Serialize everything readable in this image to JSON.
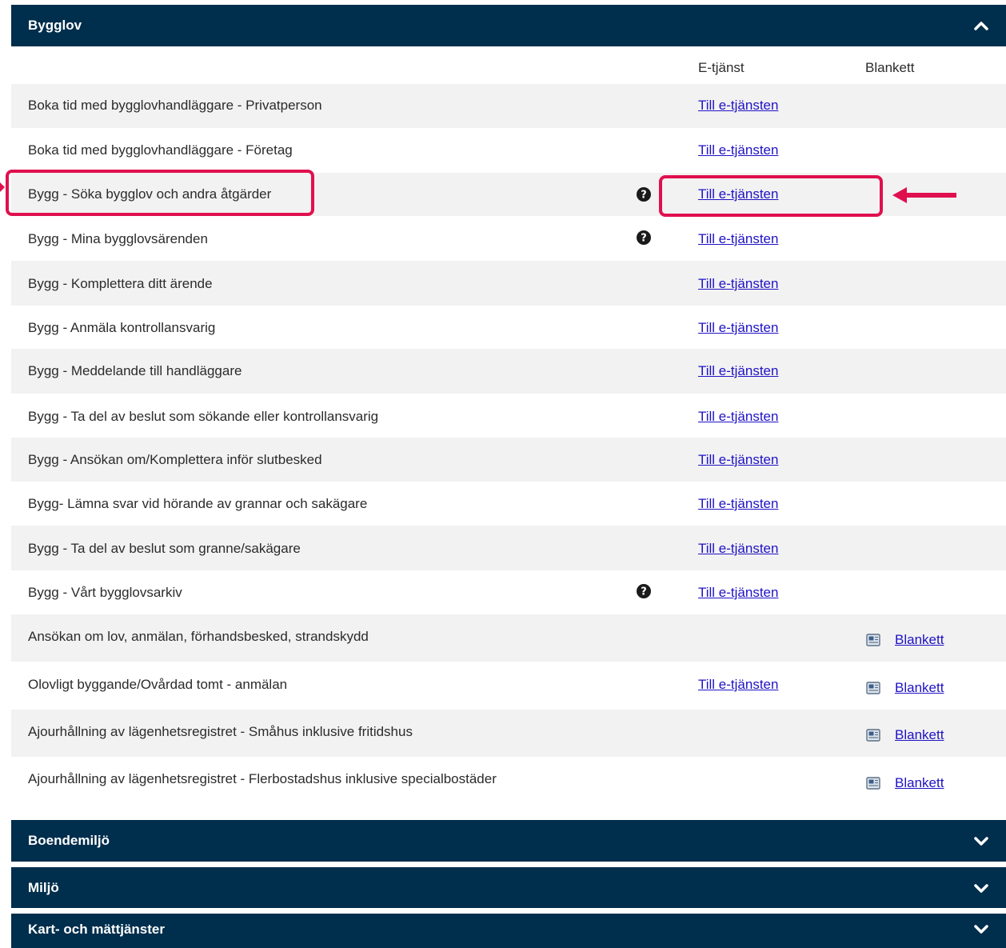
{
  "sections": {
    "bygglov": {
      "title": "Bygglov",
      "expanded": true
    },
    "boendemiljo": {
      "title": "Boendemiljö",
      "expanded": false
    },
    "miljo": {
      "title": "Miljö",
      "expanded": false
    },
    "kart": {
      "title": "Kart- och mättjänster",
      "expanded": false
    }
  },
  "columns": {
    "eservice": "E-tjänst",
    "form": "Blankett"
  },
  "rows": [
    {
      "title": "Boka tid med bygglovhandläggare - Privatperson",
      "help": false,
      "eservice": "Till e-tjänsten",
      "form": ""
    },
    {
      "title": "Boka tid med bygglovhandläggare - Företag",
      "help": false,
      "eservice": "Till e-tjänsten",
      "form": ""
    },
    {
      "title": "Bygg - Söka bygglov och andra åtgärder",
      "help": true,
      "eservice": "Till e-tjänsten",
      "form": ""
    },
    {
      "title": "Bygg - Mina bygglovsärenden",
      "help": true,
      "eservice": "Till e-tjänsten",
      "form": ""
    },
    {
      "title": "Bygg - Komplettera ditt ärende",
      "help": false,
      "eservice": "Till e-tjänsten",
      "form": ""
    },
    {
      "title": "Bygg - Anmäla kontrollansvarig",
      "help": false,
      "eservice": "Till e-tjänsten",
      "form": ""
    },
    {
      "title": "Bygg - Meddelande till handläggare",
      "help": false,
      "eservice": "Till e-tjänsten",
      "form": ""
    },
    {
      "title": "Bygg - Ta del av beslut som sökande eller kontrollansvarig",
      "help": false,
      "eservice": "Till e-tjänsten",
      "form": ""
    },
    {
      "title": "Bygg - Ansökan om/Komplettera inför slutbesked",
      "help": false,
      "eservice": "Till e-tjänsten",
      "form": ""
    },
    {
      "title": "Bygg- Lämna svar vid hörande av grannar och sakägare",
      "help": false,
      "eservice": "Till e-tjänsten",
      "form": ""
    },
    {
      "title": "Bygg - Ta del av beslut som granne/sakägare",
      "help": false,
      "eservice": "Till e-tjänsten",
      "form": ""
    },
    {
      "title": "Bygg - Vårt bygglovsarkiv",
      "help": true,
      "eservice": "Till e-tjänsten",
      "form": ""
    },
    {
      "title": "Ansökan om lov, anmälan, förhandsbesked, strandskydd",
      "help": false,
      "eservice": "",
      "form": "Blankett"
    },
    {
      "title": "Olovligt byggande/Ovårdad tomt - anmälan",
      "help": false,
      "eservice": "Till e-tjänsten",
      "form": "Blankett"
    },
    {
      "title": "Ajourhållning av lägenhetsregistret - Småhus inklusive fritidshus",
      "help": false,
      "eservice": "",
      "form": "Blankett"
    },
    {
      "title": "Ajourhållning av lägenhetsregistret - Flerbostadshus inklusive specialbostäder",
      "help": false,
      "eservice": "",
      "form": "Blankett"
    }
  ],
  "icons": {
    "help": "question-circle-icon",
    "form": "document-icon",
    "expand": "chevron-down-icon",
    "collapse": "chevron-up-icon",
    "annotation": "arrow-left-icon"
  },
  "colors": {
    "header_bg": "#002e4d",
    "row_shade": "#f2f2f2",
    "link": "#1f12c4",
    "highlight": "#e0104f"
  }
}
